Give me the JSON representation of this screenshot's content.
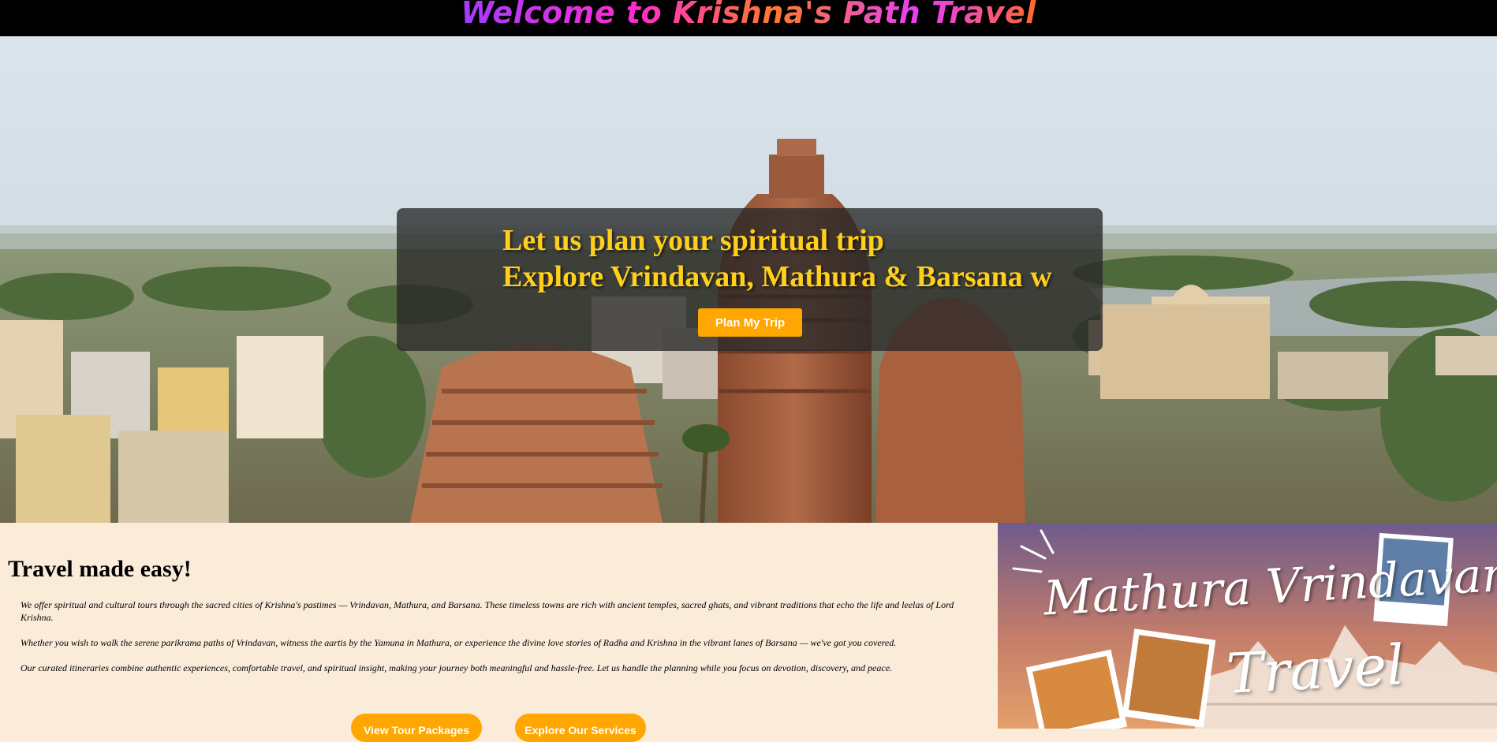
{
  "header": {
    "title": "Welcome to Krishna's Path Travel"
  },
  "hero": {
    "line1": "Let us plan your spiritual trip",
    "line2": "Explore Vrindavan, Mathura & Barsana w",
    "cta_label": "Plan My Trip"
  },
  "info": {
    "heading": "Travel made easy!",
    "paragraphs": [
      "We offer spiritual and cultural tours through the sacred cities of Krishna's pastimes — Vrindavan, Mathura, and Barsana. These timeless towns are rich with ancient temples, sacred ghats, and vibrant traditions that echo the life and leelas of Lord Krishna.",
      "Whether you wish to walk the serene parikrama paths of Vrindavan, witness the aartis by the Yamuna in Mathura, or experience the divine love stories of Radha and Krishna in the vibrant lanes of Barsana — we've got you covered.",
      "Our curated itineraries combine authentic experiences, comfortable travel, and spiritual insight, making your journey both meaningful and hassle-free. Let us handle the planning while you focus on devotion, discovery, and peace."
    ],
    "buttons": [
      "View Tour Packages",
      "Explore Our Services"
    ]
  },
  "promo": {
    "title_line1": "Mathura Vrindavan",
    "title_line2": "Travel"
  },
  "colors": {
    "accent": "#ffa600",
    "hero_text": "#ffcf1a",
    "section_bg": "#fbebd9",
    "header_bg": "#000000"
  }
}
